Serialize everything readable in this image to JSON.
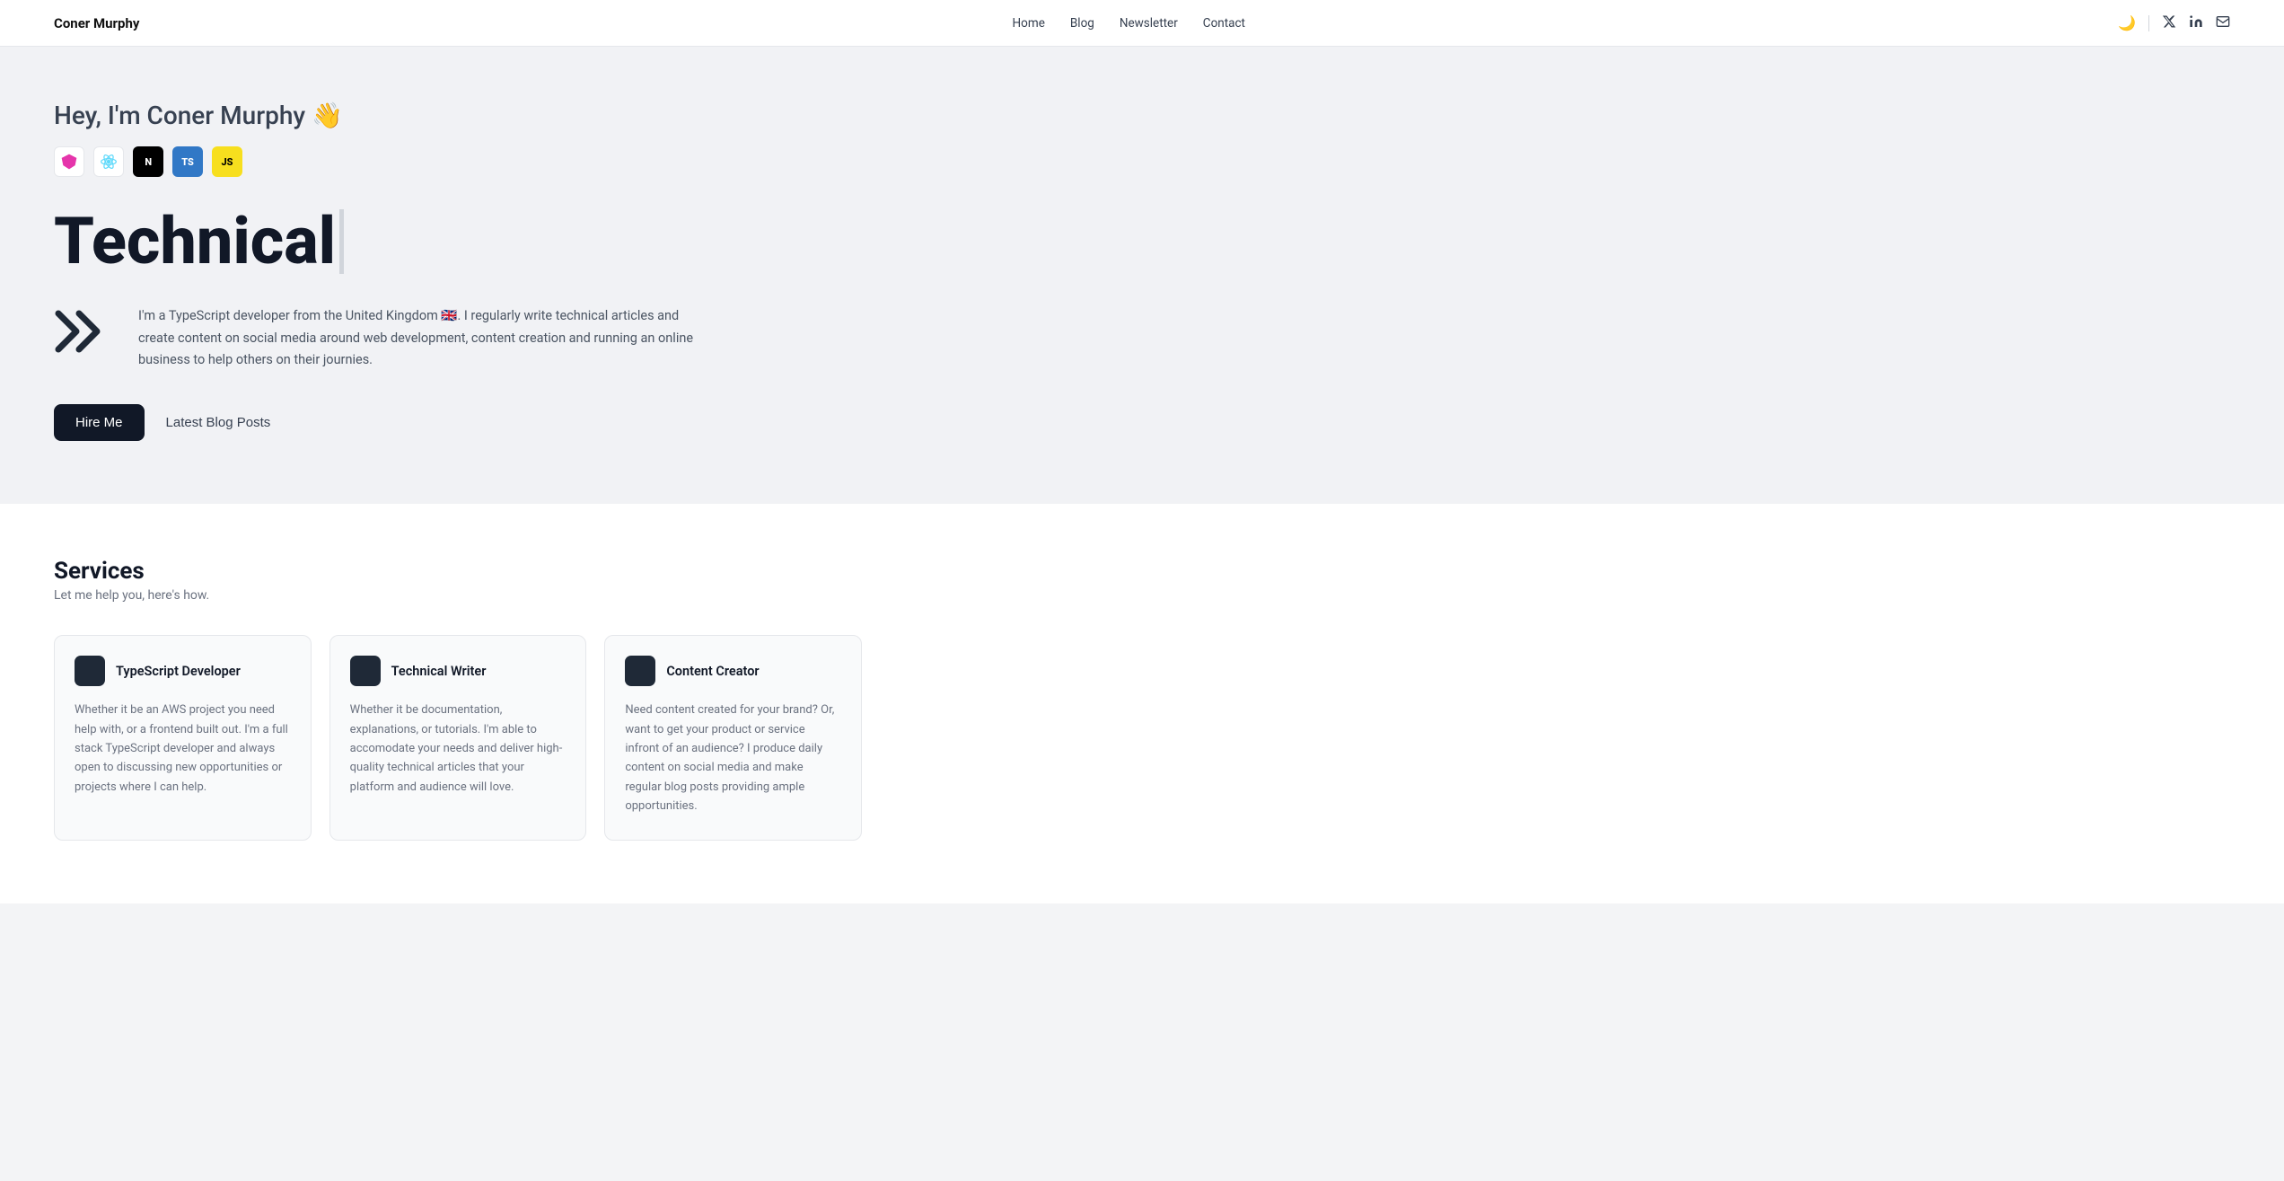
{
  "nav": {
    "logo": "Coner Murphy",
    "links": [
      {
        "label": "Home",
        "href": "#"
      },
      {
        "label": "Blog",
        "href": "#"
      },
      {
        "label": "Newsletter",
        "href": "#"
      },
      {
        "label": "Contact",
        "href": "#"
      }
    ],
    "icons": {
      "moon": "🌙",
      "twitter": "𝕏",
      "linkedin": "in",
      "email": "✉"
    }
  },
  "hero": {
    "greeting": "Hey, I'm Coner Murphy 👋",
    "badges": [
      {
        "name": "GraphQL",
        "display": "✦"
      },
      {
        "name": "React",
        "display": "⚛"
      },
      {
        "name": "Next.js",
        "display": "N"
      },
      {
        "name": "TypeScript",
        "display": "TS"
      },
      {
        "name": "JavaScript",
        "display": "JS"
      }
    ],
    "title": "Technical",
    "description": "I'm a TypeScript developer from the United Kingdom 🇬🇧. I regularly write technical articles and create content on social media around web development, content creation and running an online business to help others on their journies.",
    "hire_me": "Hire Me",
    "latest_posts": "Latest Blog Posts"
  },
  "services": {
    "title": "Services",
    "subtitle": "Let me help you, here's how.",
    "cards": [
      {
        "title": "TypeScript Developer",
        "description": "Whether it be an AWS project you need help with, or a frontend built out. I'm a full stack TypeScript developer and always open to discussing new opportunities or projects where I can help."
      },
      {
        "title": "Technical Writer",
        "description": "Whether it be documentation, explanations, or tutorials. I'm able to accomodate your needs and deliver high-quality technical articles that your platform and audience will love."
      },
      {
        "title": "Content Creator",
        "description": "Need content created for your brand? Or, want to get your product or service infront of an audience? I produce daily content on social media and make regular blog posts providing ample opportunities."
      }
    ]
  }
}
